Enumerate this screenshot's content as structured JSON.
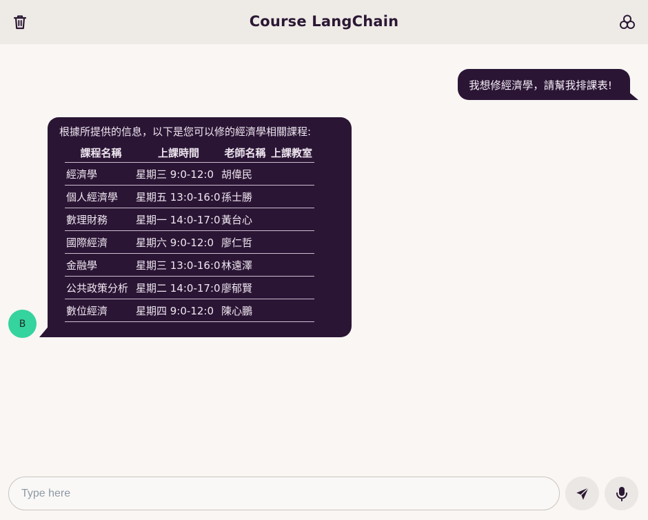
{
  "header": {
    "title": "Course LangChain",
    "left_icon": "trash-icon",
    "right_icon": "group-icon"
  },
  "messages": {
    "user": "我想修經濟學，請幫我排課表!",
    "bot": {
      "intro": "根據所提供的信息，以下是您可以修的經濟學相關課程:",
      "headers": [
        "課程名稱",
        "上課時間",
        "老師名稱",
        "上課教室"
      ],
      "rows": [
        [
          "經濟學",
          "星期三 9:0-12:0",
          "胡偉民",
          ""
        ],
        [
          "個人經濟學",
          "星期五 13:0-16:0",
          "孫士勝",
          ""
        ],
        [
          "數理財務",
          "星期一 14:0-17:0",
          "黃台心",
          ""
        ],
        [
          "國際經濟",
          "星期六 9:0-12:0",
          "廖仁哲",
          ""
        ],
        [
          "金融學",
          "星期三 13:0-16:0",
          "林遠澤",
          ""
        ],
        [
          "公共政策分析",
          "星期二 14:0-17:0",
          "廖郁賢",
          ""
        ],
        [
          "數位經濟",
          "星期四 9:0-12:0",
          "陳心鵬",
          ""
        ]
      ],
      "avatar_initial": "B"
    }
  },
  "composer": {
    "placeholder": "Type here",
    "value": "",
    "send_icon": "send-icon",
    "mic_icon": "microphone-icon"
  },
  "colors": {
    "bubble": "#2b1535",
    "avatar": "#35d39e",
    "header_bg": "#eeeae6",
    "page_bg": "#f9f6f3"
  }
}
